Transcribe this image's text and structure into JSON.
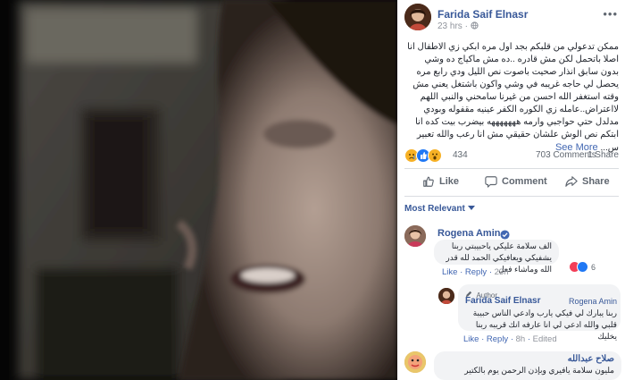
{
  "post": {
    "author": "Farida Saif Elnasr",
    "time": "23 hrs",
    "body": "ممكن تدعولي من قلبكم بجد اول مره ابكي زي الاطفال انا اصلا باتحمل لكن مش قادره ..ده مش ماكياج ده وشي بدون سابق انذار صحيت باصوت نص الليل ودي رابع مره يحصل لي حاجه غريبه في وشي واكون باشتغل يعني مش وقته استغفر الله احسن من غيرنا سامحني والنبي اللهم لااعتراض..عامله زي الكوره الكفر عينيه مقفوله وبودي مدلدل حتي حواجبي وارمه هههههههه بيضرب بيت كده انا ابتكم نص الوش علشان حقيقي مش انا رعب والله تعبير س...",
    "see_more": "See More",
    "reactions_count": "434",
    "comments_count": "703 Comments",
    "shares_count": "1 Share",
    "more_label": "•••"
  },
  "actions": {
    "like": "Like",
    "comment": "Comment",
    "share": "Share"
  },
  "sort": {
    "label": "Most Relevant"
  },
  "comments": [
    {
      "name": "Rogena Amin",
      "text": "الف سلامة عليكي ياحبيبتي ربنا يشفيكي ويعافيكي الحمد لله قدر الله وماشاء فعل",
      "like": "Like",
      "reply": "Reply",
      "time": "23h",
      "reaction_count": "6"
    },
    {
      "badge": "Author",
      "name": "Farida Saif Elnasr",
      "mention": "Rogena Amin",
      "text": "ربنا يبارك لي فيكي يارب وادعي الناس حبيبة قلبي والله ادعي لي انا عارفه انك قريبه ربنا يخليك",
      "like": "Like",
      "reply": "Reply",
      "time": "8h",
      "edited": "Edited"
    },
    {
      "name": "صلاح عبدالله",
      "text": "مليون سلامة يافيري وبإذن الرحمن يوم بالكتير وهتبقي زي"
    }
  ]
}
